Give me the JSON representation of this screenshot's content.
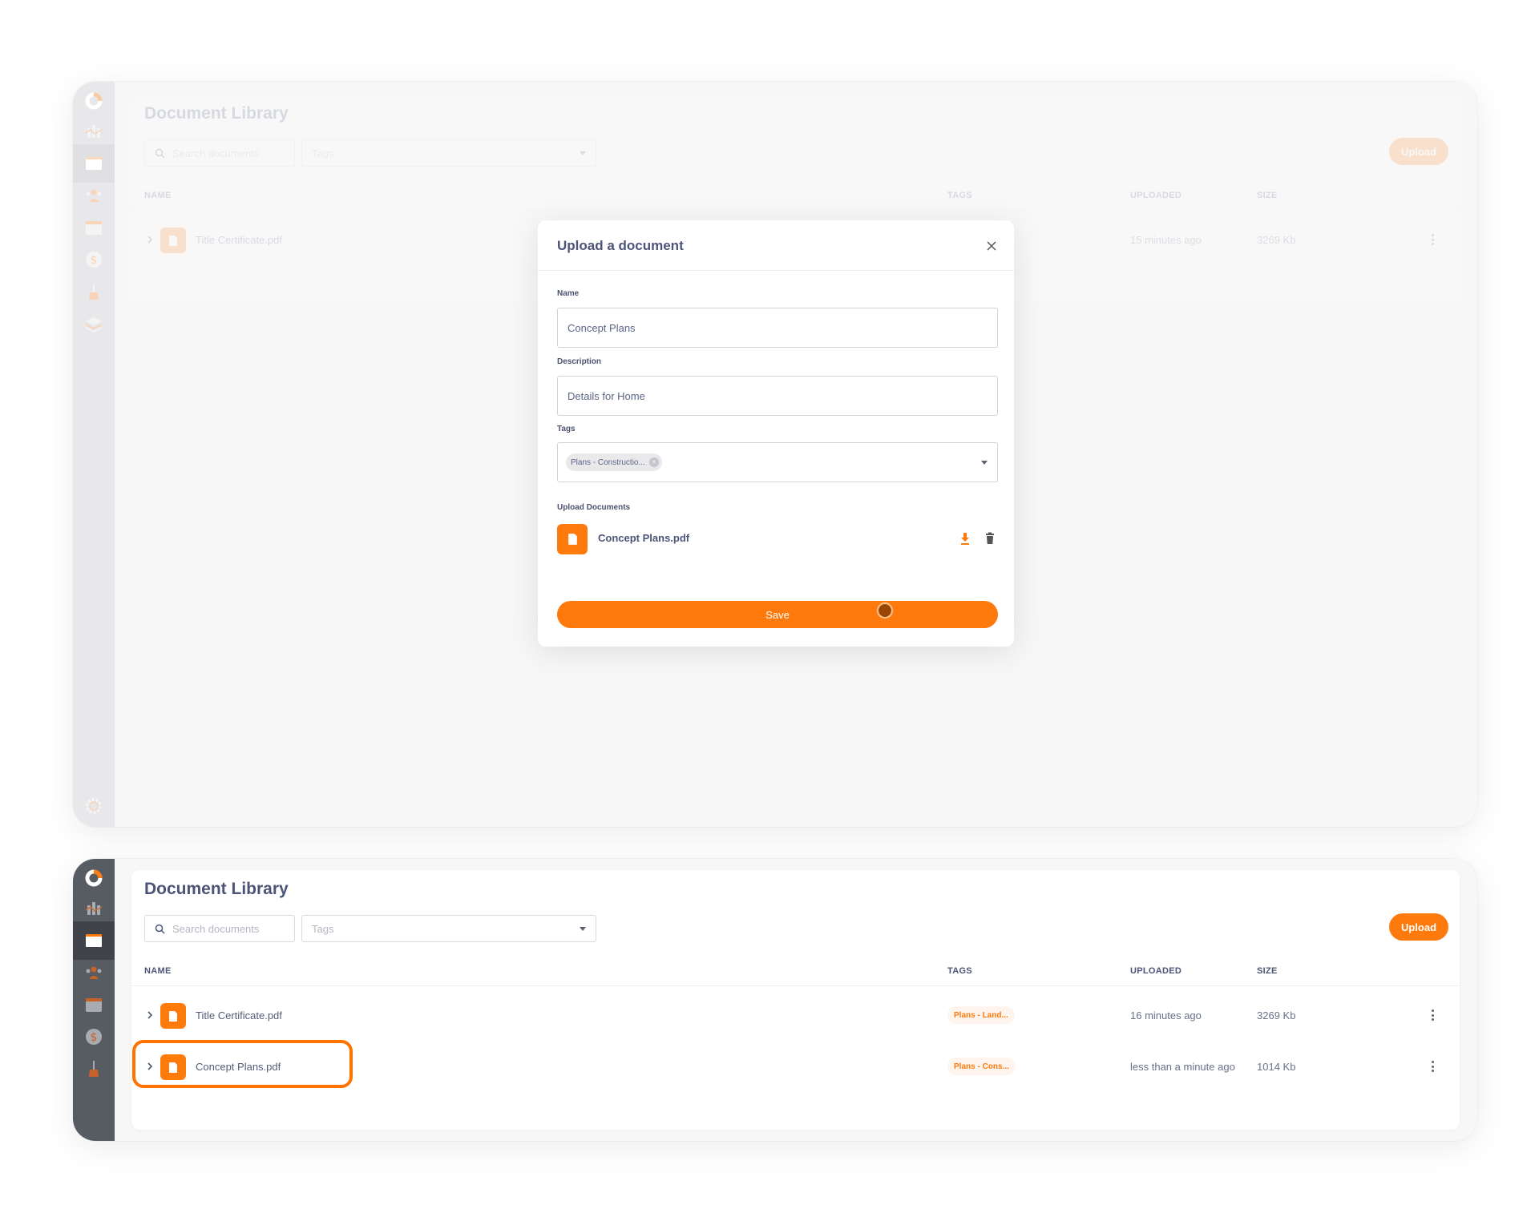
{
  "colors": {
    "accent": "#ff7a0d",
    "highlight": "#ff7400",
    "sidebar_bg": "#575c63",
    "sidebar_active": "#40444a",
    "text_primary": "#4c5478",
    "tag_bg": "#fff5ee"
  },
  "sidebar": {
    "items": [
      {
        "name": "logo",
        "icon": "app-logo-icon"
      },
      {
        "name": "dashboard",
        "icon": "chart-bars-icon"
      },
      {
        "name": "documents",
        "icon": "folder-icon",
        "active": true
      },
      {
        "name": "contacts",
        "icon": "users-icon"
      },
      {
        "name": "calendar",
        "icon": "calendar-icon"
      },
      {
        "name": "finance",
        "icon": "dollar-icon"
      },
      {
        "name": "design",
        "icon": "paintbrush-icon"
      },
      {
        "name": "layers",
        "icon": "layers-icon"
      },
      {
        "name": "settings",
        "icon": "gear-icon"
      }
    ]
  },
  "top_screen": {
    "page_title": "Document Library",
    "search_placeholder": "Search documents",
    "tags_placeholder": "Tags",
    "upload_label": "Upload",
    "columns": {
      "name": "NAME",
      "tags": "TAGS",
      "uploaded": "UPLOADED",
      "size": "SIZE"
    },
    "rows": [
      {
        "name": "Title Certificate.pdf",
        "tag": "",
        "uploaded": "15 minutes ago",
        "size": "3269 Kb"
      }
    ],
    "modal": {
      "title": "Upload a document",
      "name_label": "Name",
      "name_value": "Concept Plans",
      "description_label": "Description",
      "description_value": "Details for Home",
      "tags_label": "Tags",
      "tag_chip": "Plans - Constructio...",
      "upload_label": "Upload Documents",
      "file_name": "Concept Plans.pdf",
      "save_label": "Save"
    }
  },
  "bottom_screen": {
    "page_title": "Document Library",
    "search_placeholder": "Search documents",
    "tags_placeholder": "Tags",
    "upload_label": "Upload",
    "columns": {
      "name": "NAME",
      "tags": "TAGS",
      "uploaded": "UPLOADED",
      "size": "SIZE"
    },
    "rows": [
      {
        "name": "Title Certificate.pdf",
        "tag": "Plans - Land...",
        "uploaded": "16 minutes ago",
        "size": "3269 Kb"
      },
      {
        "name": "Concept Plans.pdf",
        "tag": "Plans - Cons...",
        "uploaded": "less than a minute ago",
        "size": "1014 Kb",
        "highlighted": true
      }
    ]
  }
}
